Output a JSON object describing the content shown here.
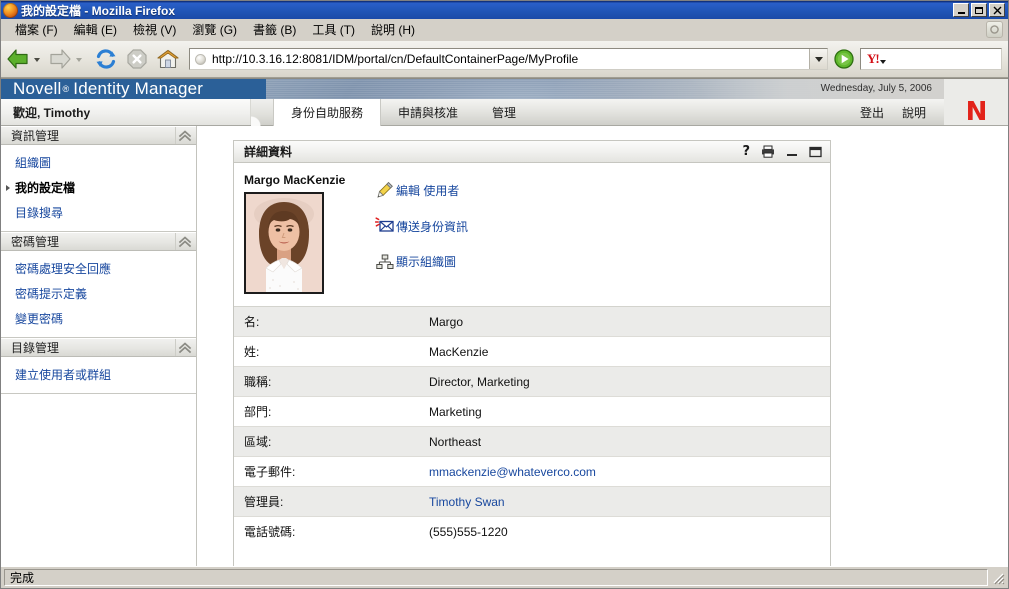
{
  "browser": {
    "window_title": "我的設定檔 - Mozilla Firefox",
    "menus": [
      "檔案 (F)",
      "編輯 (E)",
      "檢視 (V)",
      "瀏覽 (G)",
      "書籤 (B)",
      "工具 (T)",
      "說明 (H)"
    ],
    "url": "http://10.3.16.12:8081/IDM/portal/cn/DefaultContainerPage/MyProfile",
    "url_placeholder": "",
    "search_placeholder": "",
    "search_value": "",
    "search_provider": "Y!",
    "status": "完成",
    "window_buttons": {
      "minimize": "_",
      "maximize": "□",
      "close": "×"
    },
    "nav": {
      "back": "back-icon",
      "forward": "forward-icon",
      "reload": "reload-icon",
      "stop": "stop-icon",
      "home": "home-icon",
      "go": "go-icon"
    }
  },
  "banner": {
    "brand_novell": "Novell",
    "brand_reg": "®",
    "brand_product": "Identity Manager",
    "date": "Wednesday, July 5, 2006",
    "logo": "N"
  },
  "topnav": {
    "welcome": "歡迎, Timothy",
    "tabs": [
      {
        "label": "身份自助服務",
        "active": true
      },
      {
        "label": "申請與核准",
        "active": false
      },
      {
        "label": "管理",
        "active": false
      }
    ],
    "utilities": [
      "登出",
      "說明"
    ]
  },
  "sidebar": {
    "groups": [
      {
        "title": "資訊管理",
        "items": [
          {
            "label": "組織圖",
            "selected": false
          },
          {
            "label": "我的設定檔",
            "selected": true
          },
          {
            "label": "目錄搜尋",
            "selected": false
          }
        ]
      },
      {
        "title": "密碼管理",
        "items": [
          {
            "label": "密碼處理安全回應",
            "selected": false
          },
          {
            "label": "密碼提示定義",
            "selected": false
          },
          {
            "label": "變更密碼",
            "selected": false
          }
        ]
      },
      {
        "title": "目錄管理",
        "items": [
          {
            "label": "建立使用者或群組",
            "selected": false
          }
        ]
      }
    ]
  },
  "portlet": {
    "title": "詳細資料",
    "tools": [
      {
        "name": "help-icon",
        "glyph": "?"
      },
      {
        "name": "print-icon",
        "glyph": ""
      },
      {
        "name": "minimize-icon",
        "glyph": ""
      },
      {
        "name": "maximize-icon",
        "glyph": ""
      }
    ],
    "person_name": "Margo MacKenzie",
    "photo_alt": "Margo MacKenzie",
    "actions": [
      {
        "icon": "pencil-icon",
        "label": "編輯 使用者"
      },
      {
        "icon": "envelope-icon",
        "label": "傳送身份資訊"
      },
      {
        "icon": "org-chart-icon",
        "label": "顯示組織圖"
      }
    ],
    "fields": [
      {
        "label": "名:",
        "value": "Margo",
        "link": false
      },
      {
        "label": "姓:",
        "value": "MacKenzie",
        "link": false
      },
      {
        "label": "職稱:",
        "value": "Director, Marketing",
        "link": false
      },
      {
        "label": "部門:",
        "value": "Marketing",
        "link": false
      },
      {
        "label": "區域:",
        "value": "Northeast",
        "link": false
      },
      {
        "label": "電子郵件:",
        "value": "mmackenzie@whateverco.com",
        "link": true
      },
      {
        "label": "管理員:",
        "value": "Timothy Swan",
        "link": true
      },
      {
        "label": "電話號碼:",
        "value": "(555)555-1220",
        "link": false
      }
    ]
  },
  "colors": {
    "brand_blue": "#2b6098",
    "link_blue": "#17479e",
    "novell_red": "#e2231a",
    "titlebar_blue": "#1f54b5",
    "chrome_gray": "#d4d0c8"
  }
}
